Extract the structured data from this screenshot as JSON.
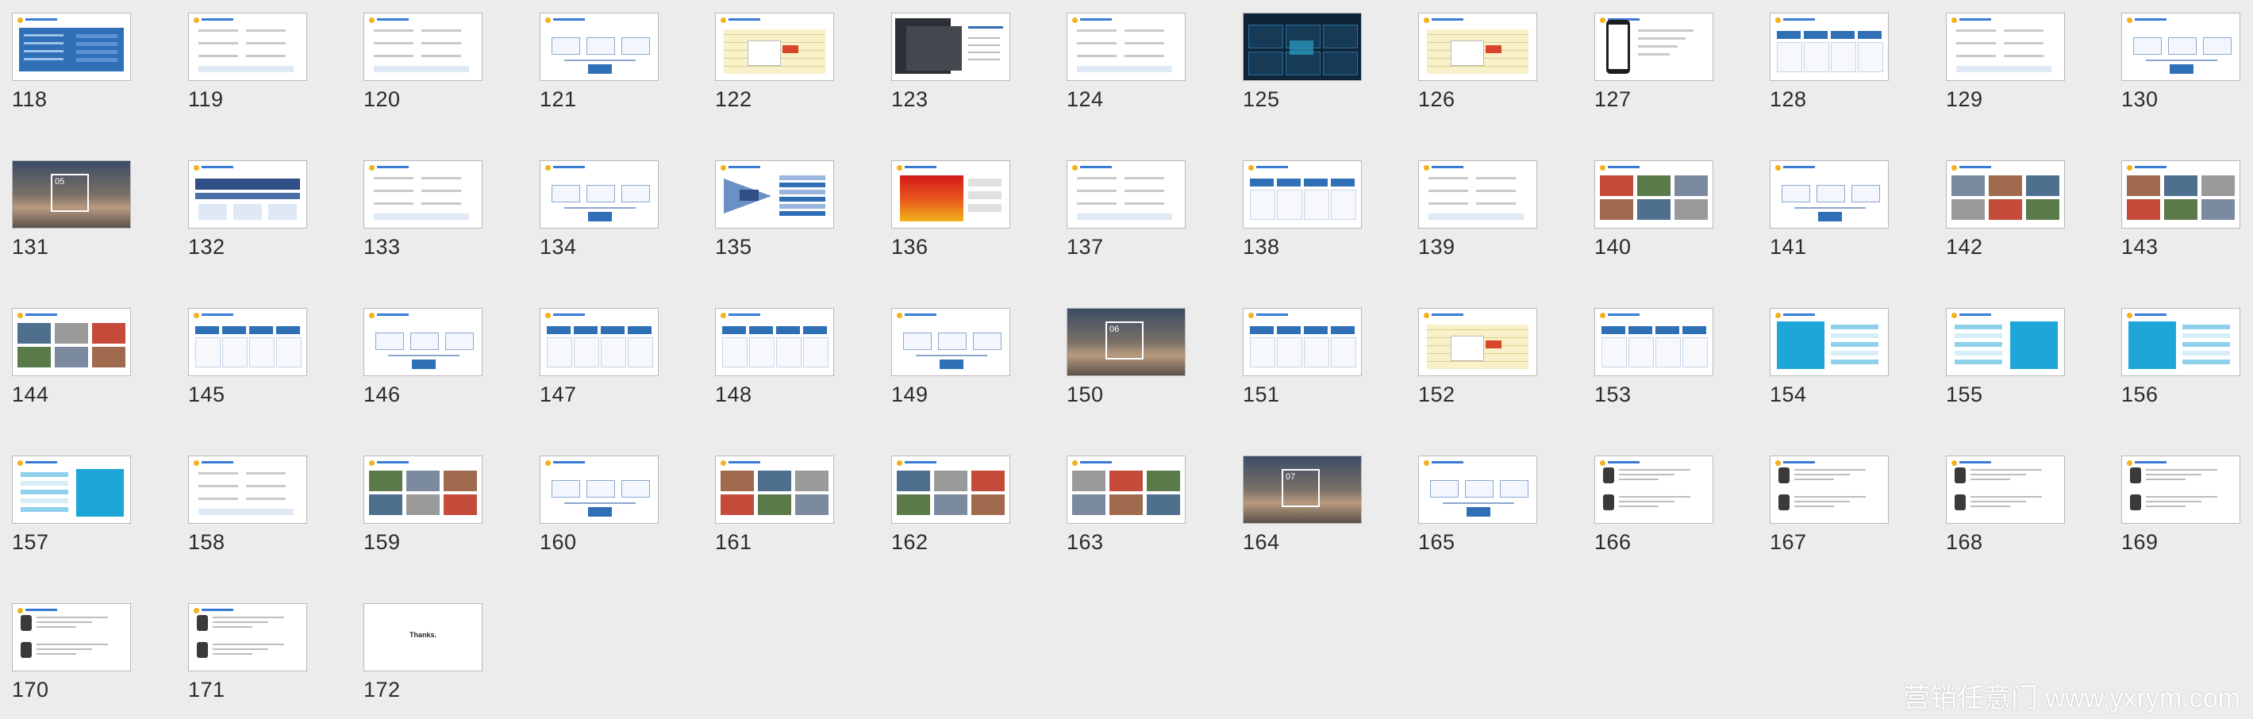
{
  "slides": [
    {
      "number": "118",
      "style": "blue-panel"
    },
    {
      "number": "119",
      "style": "text-lines"
    },
    {
      "number": "120",
      "style": "text-lines"
    },
    {
      "number": "121",
      "style": "diagram"
    },
    {
      "number": "122",
      "style": "table-yellow"
    },
    {
      "number": "123",
      "style": "dark-screens"
    },
    {
      "number": "124",
      "style": "text-lines"
    },
    {
      "number": "125",
      "style": "dark-dashboard"
    },
    {
      "number": "126",
      "style": "table-yellow"
    },
    {
      "number": "127",
      "style": "phone"
    },
    {
      "number": "128",
      "style": "blue-boxes"
    },
    {
      "number": "129",
      "style": "text-lines"
    },
    {
      "number": "130",
      "style": "diagram"
    },
    {
      "number": "131",
      "style": "section-photo",
      "label": "05"
    },
    {
      "number": "132",
      "style": "blue-banner"
    },
    {
      "number": "133",
      "style": "text-lines"
    },
    {
      "number": "134",
      "style": "diagram"
    },
    {
      "number": "135",
      "style": "funnel"
    },
    {
      "number": "136",
      "style": "heatmap"
    },
    {
      "number": "137",
      "style": "text-lines"
    },
    {
      "number": "138",
      "style": "blue-boxes"
    },
    {
      "number": "139",
      "style": "text-lines"
    },
    {
      "number": "140",
      "style": "photos"
    },
    {
      "number": "141",
      "style": "diagram"
    },
    {
      "number": "142",
      "style": "photos"
    },
    {
      "number": "143",
      "style": "photos"
    },
    {
      "number": "144",
      "style": "photos"
    },
    {
      "number": "145",
      "style": "blue-boxes"
    },
    {
      "number": "146",
      "style": "diagram"
    },
    {
      "number": "147",
      "style": "blue-boxes"
    },
    {
      "number": "148",
      "style": "blue-boxes"
    },
    {
      "number": "149",
      "style": "diagram"
    },
    {
      "number": "150",
      "style": "section-photo",
      "label": "06"
    },
    {
      "number": "151",
      "style": "blue-boxes"
    },
    {
      "number": "152",
      "style": "table-yellow"
    },
    {
      "number": "153",
      "style": "blue-boxes"
    },
    {
      "number": "154",
      "style": "cyan-panel"
    },
    {
      "number": "155",
      "style": "cyan-panel"
    },
    {
      "number": "156",
      "style": "cyan-panel"
    },
    {
      "number": "157",
      "style": "cyan-panel"
    },
    {
      "number": "158",
      "style": "text-lines"
    },
    {
      "number": "159",
      "style": "photos"
    },
    {
      "number": "160",
      "style": "diagram"
    },
    {
      "number": "161",
      "style": "photos"
    },
    {
      "number": "162",
      "style": "photos"
    },
    {
      "number": "163",
      "style": "photos"
    },
    {
      "number": "164",
      "style": "section-photo",
      "label": "07"
    },
    {
      "number": "165",
      "style": "diagram"
    },
    {
      "number": "166",
      "style": "people"
    },
    {
      "number": "167",
      "style": "people"
    },
    {
      "number": "168",
      "style": "people"
    },
    {
      "number": "169",
      "style": "people"
    },
    {
      "number": "170",
      "style": "people"
    },
    {
      "number": "171",
      "style": "people"
    },
    {
      "number": "172",
      "style": "thanks",
      "label": "Thanks."
    }
  ],
  "watermark": "营销任意门 www.yxrym.com",
  "colors": {
    "background": "#ececec",
    "number": "#2b2b2b",
    "accent_blue": "#2f6fb6",
    "accent_cyan": "#1fa6d9",
    "accent_yellow": "#f2b21b"
  }
}
